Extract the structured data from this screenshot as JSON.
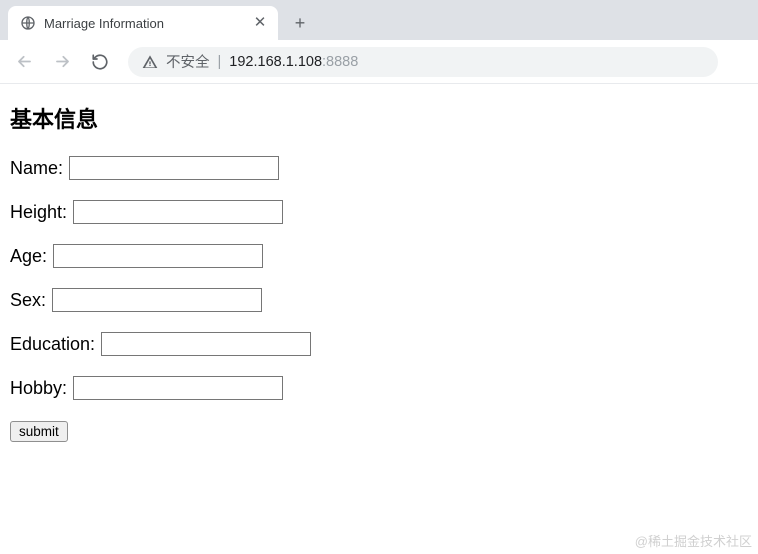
{
  "browser": {
    "tab_title": "Marriage Information",
    "security_text": "不安全",
    "url_host": "192.168.1.108",
    "url_port": ":8888"
  },
  "page": {
    "heading": "基本信息",
    "fields": {
      "name": {
        "label": "Name:",
        "value": ""
      },
      "height": {
        "label": "Height:",
        "value": ""
      },
      "age": {
        "label": "Age:",
        "value": ""
      },
      "sex": {
        "label": "Sex:",
        "value": ""
      },
      "education": {
        "label": "Education:",
        "value": ""
      },
      "hobby": {
        "label": "Hobby:",
        "value": ""
      }
    },
    "submit_label": "submit"
  },
  "watermark": "@稀土掘金技术社区"
}
